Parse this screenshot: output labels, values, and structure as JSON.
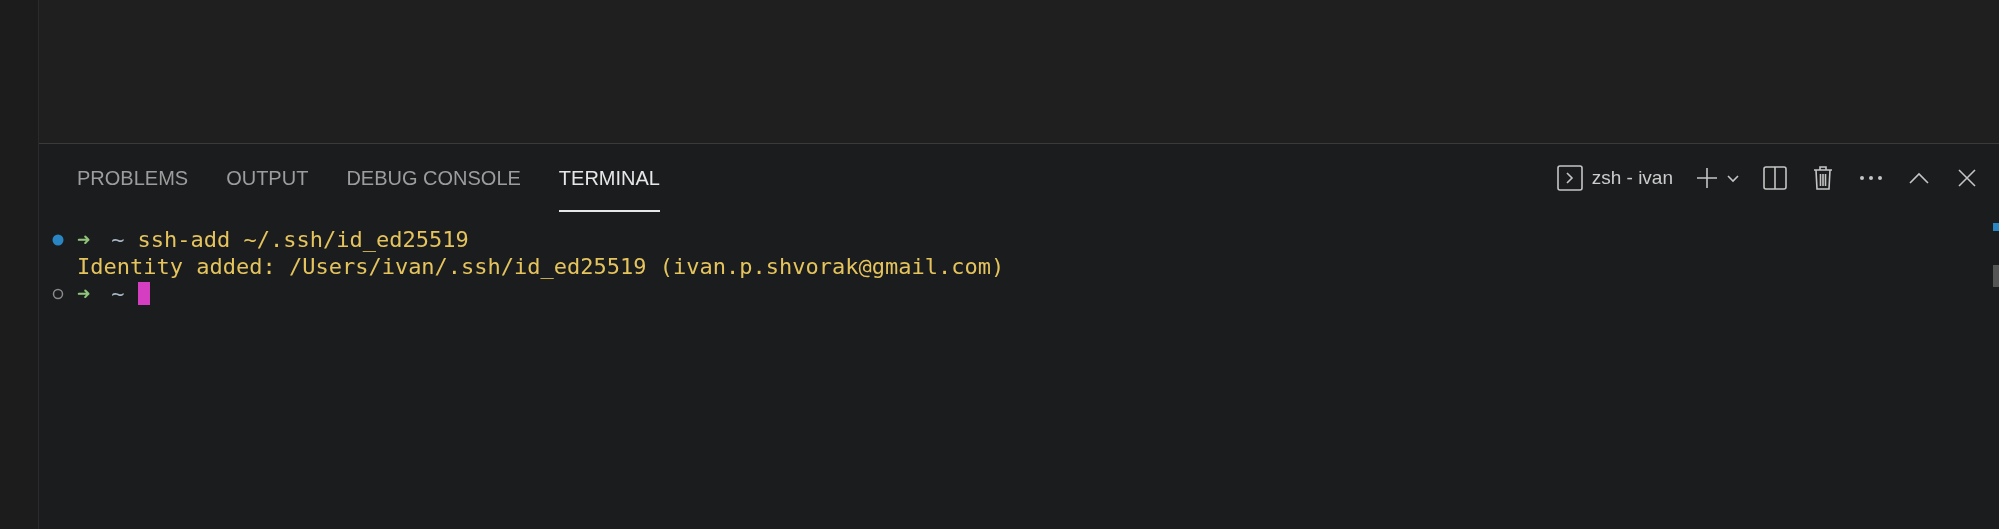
{
  "panel": {
    "tabs": [
      {
        "label": "PROBLEMS",
        "selected": false
      },
      {
        "label": "OUTPUT",
        "selected": false
      },
      {
        "label": "DEBUG CONSOLE",
        "selected": false
      },
      {
        "label": "TERMINAL",
        "selected": true
      }
    ],
    "terminal_name": "zsh - ivan"
  },
  "terminal": {
    "lines": [
      {
        "kind": "prompt",
        "success": true,
        "arrow": "➜",
        "dir": "~",
        "command": "ssh-add ~/.ssh/id_ed25519"
      },
      {
        "kind": "output",
        "text": "Identity added: /Users/ivan/.ssh/id_ed25519 (ivan.p.shvorak@gmail.com)"
      },
      {
        "kind": "prompt",
        "success": false,
        "arrow": "➜",
        "dir": "~",
        "cursor": true
      }
    ]
  }
}
